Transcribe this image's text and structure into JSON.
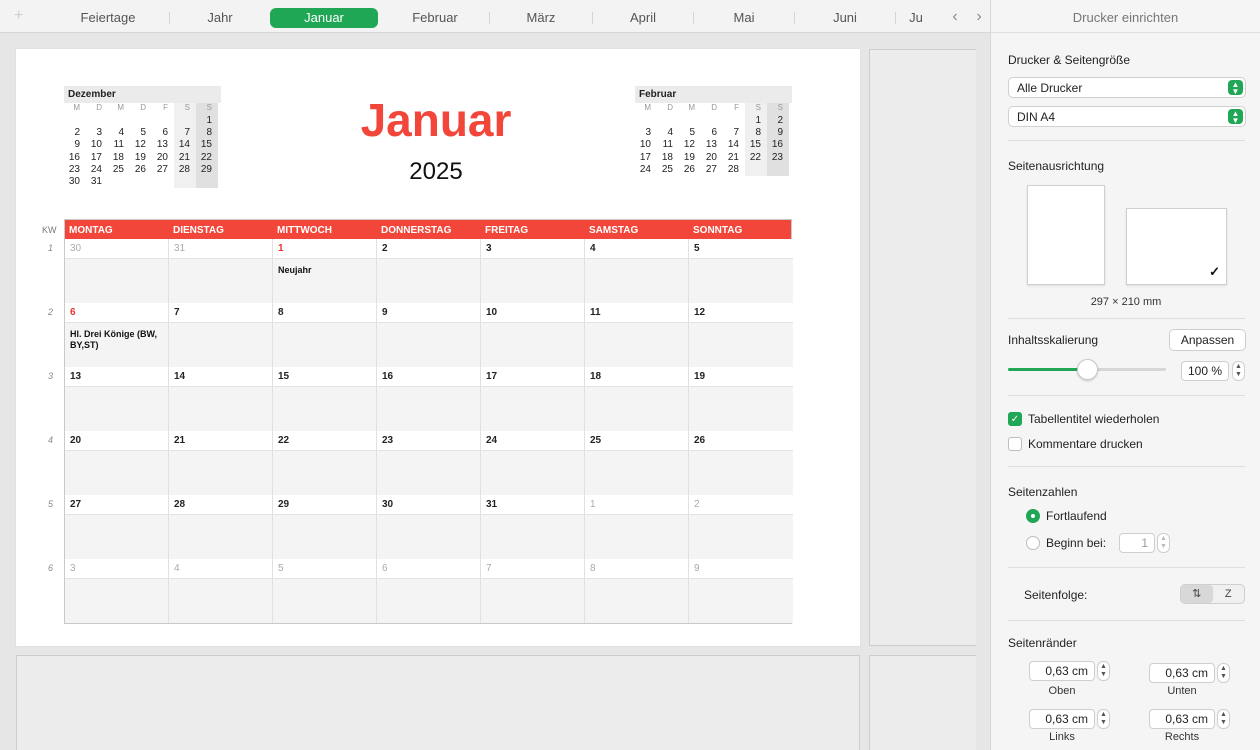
{
  "tabs": {
    "items": [
      {
        "label": "Feiertage",
        "active": false
      },
      {
        "label": "Jahr",
        "active": false
      },
      {
        "label": "Januar",
        "active": true
      },
      {
        "label": "Februar",
        "active": false
      },
      {
        "label": "März",
        "active": false
      },
      {
        "label": "April",
        "active": false
      },
      {
        "label": "Mai",
        "active": false
      },
      {
        "label": "Juni",
        "active": false
      },
      {
        "label": "Ju",
        "active": false
      }
    ],
    "add_icon": "plus-icon",
    "prev_icon": "chevron-left-icon",
    "next_icon": "chevron-right-icon",
    "accent": "#1fa755"
  },
  "calendar": {
    "title": "Januar",
    "year": "2025",
    "title_color": "#f2463a",
    "kw_label": "KW",
    "headers": [
      "MONTAG",
      "DIENSTAG",
      "MITTWOCH",
      "DONNERSTAG",
      "FREITAG",
      "SAMSTAG",
      "SONNTAG"
    ],
    "weeks": [
      {
        "kw": "1",
        "days": [
          {
            "d": "30",
            "other": true
          },
          {
            "d": "31",
            "other": true
          },
          {
            "d": "1",
            "holiday": true,
            "note": "Neujahr"
          },
          {
            "d": "2"
          },
          {
            "d": "3"
          },
          {
            "d": "4"
          },
          {
            "d": "5"
          }
        ]
      },
      {
        "kw": "2",
        "days": [
          {
            "d": "6",
            "holiday": true,
            "note": "Hl. Drei Könige (BW, BY,ST)"
          },
          {
            "d": "7"
          },
          {
            "d": "8"
          },
          {
            "d": "9"
          },
          {
            "d": "10"
          },
          {
            "d": "11"
          },
          {
            "d": "12"
          }
        ]
      },
      {
        "kw": "3",
        "days": [
          {
            "d": "13"
          },
          {
            "d": "14"
          },
          {
            "d": "15"
          },
          {
            "d": "16"
          },
          {
            "d": "17"
          },
          {
            "d": "18"
          },
          {
            "d": "19"
          }
        ]
      },
      {
        "kw": "4",
        "days": [
          {
            "d": "20"
          },
          {
            "d": "21"
          },
          {
            "d": "22"
          },
          {
            "d": "23"
          },
          {
            "d": "24"
          },
          {
            "d": "25"
          },
          {
            "d": "26"
          }
        ]
      },
      {
        "kw": "5",
        "days": [
          {
            "d": "27"
          },
          {
            "d": "28"
          },
          {
            "d": "29"
          },
          {
            "d": "30"
          },
          {
            "d": "31"
          },
          {
            "d": "1",
            "other": true
          },
          {
            "d": "2",
            "other": true
          }
        ]
      },
      {
        "kw": "6",
        "days": [
          {
            "d": "3",
            "other": true
          },
          {
            "d": "4",
            "other": true
          },
          {
            "d": "5",
            "other": true
          },
          {
            "d": "6",
            "other": true
          },
          {
            "d": "7",
            "other": true
          },
          {
            "d": "8",
            "other": true
          },
          {
            "d": "9",
            "other": true
          }
        ]
      }
    ]
  },
  "mini_prev": {
    "title": "Dezember",
    "weekdays": [
      "M",
      "D",
      "M",
      "D",
      "F",
      "S",
      "S"
    ],
    "cells": [
      "",
      "",
      "",
      "",
      "",
      "",
      "1",
      "2",
      "3",
      "4",
      "5",
      "6",
      "7",
      "8",
      "9",
      "10",
      "11",
      "12",
      "13",
      "14",
      "15",
      "16",
      "17",
      "18",
      "19",
      "20",
      "21",
      "22",
      "23",
      "24",
      "25",
      "26",
      "27",
      "28",
      "29",
      "30",
      "31",
      "",
      "",
      "",
      "",
      ""
    ]
  },
  "mini_next": {
    "title": "Februar",
    "weekdays": [
      "M",
      "D",
      "M",
      "D",
      "F",
      "S",
      "S"
    ],
    "cells": [
      "",
      "",
      "",
      "",
      "",
      "1",
      "2",
      "3",
      "4",
      "5",
      "6",
      "7",
      "8",
      "9",
      "10",
      "11",
      "12",
      "13",
      "14",
      "15",
      "16",
      "17",
      "18",
      "19",
      "20",
      "21",
      "22",
      "23",
      "24",
      "25",
      "26",
      "27",
      "28",
      "",
      ""
    ]
  },
  "panel": {
    "title": "Drucker einrichten",
    "printer_section": "Drucker & Seitengröße",
    "printer": "Alle Drucker",
    "paper": "DIN A4",
    "orientation_label": "Seitenausrichtung",
    "orientation_selected": "landscape",
    "paper_size": "297 × 210 mm",
    "scaling_label": "Inhaltsskalierung",
    "fit_button": "Anpassen",
    "scale_value": "100 %",
    "scale_fraction": 0.5,
    "repeat_headers_label": "Tabellentitel wiederholen",
    "repeat_headers": true,
    "print_comments_label": "Kommentare drucken",
    "print_comments": false,
    "page_numbers_label": "Seitenzahlen",
    "continuous_label": "Fortlaufend",
    "start_at_label": "Beginn bei:",
    "start_at_value": "1",
    "page_order_label": "Seitenfolge:",
    "margins_label": "Seitenränder",
    "margins": {
      "top": {
        "value": "0,63 cm",
        "label": "Oben"
      },
      "bottom": {
        "value": "0,63 cm",
        "label": "Unten"
      },
      "left": {
        "value": "0,63 cm",
        "label": "Links"
      },
      "right": {
        "value": "0,63 cm",
        "label": "Rechts"
      }
    }
  }
}
